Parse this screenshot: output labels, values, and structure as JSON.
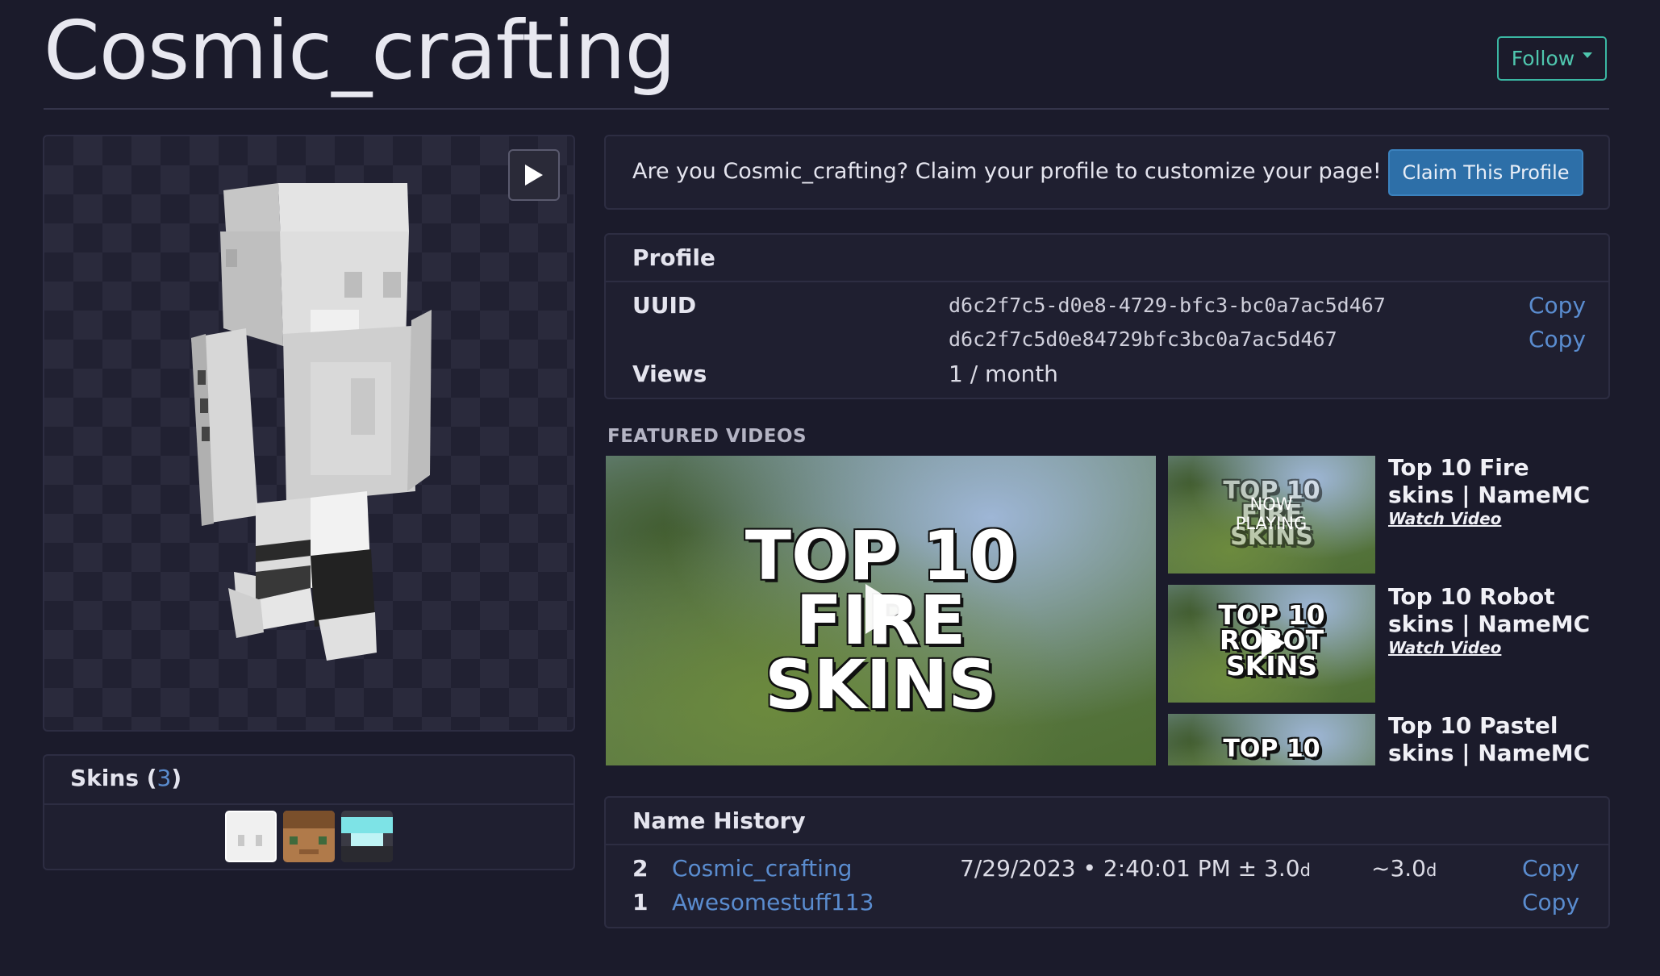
{
  "header": {
    "title": "Cosmic_crafting",
    "follow_label": "Follow"
  },
  "skins": {
    "label": "Skins (",
    "count": "3",
    "close": ")"
  },
  "claim": {
    "text": "Are you Cosmic_crafting? Claim your profile to customize your page!",
    "button": "Claim This Profile"
  },
  "profile": {
    "heading": "Profile",
    "uuid_label": "UUID",
    "uuid": "d6c2f7c5-d0e8-4729-bfc3-bc0a7ac5d467",
    "uuid_plain": "d6c2f7c5d0e84729bfc3bc0a7ac5d467",
    "copy_label": "Copy",
    "views_label": "Views",
    "views_value": "1 / month"
  },
  "featured": {
    "heading": "FEATURED VIDEOS",
    "main_thumb_lines": [
      "TOP 10",
      "FIRE",
      "SKINS"
    ],
    "now_playing": "NOW PLAYING",
    "videos": [
      {
        "title": "Top 10 Fire skins | NameMC",
        "watch": "Watch Video",
        "thumb_lines": [
          "TOP 10",
          "FIRE",
          "SKINS"
        ]
      },
      {
        "title": "Top 10 Robot skins | NameMC",
        "watch": "Watch Video",
        "thumb_lines": [
          "TOP 10",
          "ROBOT",
          "SKINS"
        ]
      },
      {
        "title": "Top 10 Pastel skins | NameMC",
        "thumb_lines": [
          "TOP 10"
        ]
      }
    ]
  },
  "name_history": {
    "heading": "Name History",
    "rows": [
      {
        "index": "2",
        "name": "Cosmic_crafting",
        "date": "7/29/2023 • 2:40:01 PM ± 3.0",
        "date_unit": "d",
        "ago": "~3.0",
        "ago_unit": "d",
        "copy": "Copy"
      },
      {
        "index": "1",
        "name": "Awesomestuff113",
        "copy": "Copy"
      }
    ]
  },
  "colors": {
    "background": "#1b1b2b",
    "accent_teal": "#3bb7a3",
    "link_blue": "#5a8ccf",
    "claim_button": "#2d6fa8"
  }
}
